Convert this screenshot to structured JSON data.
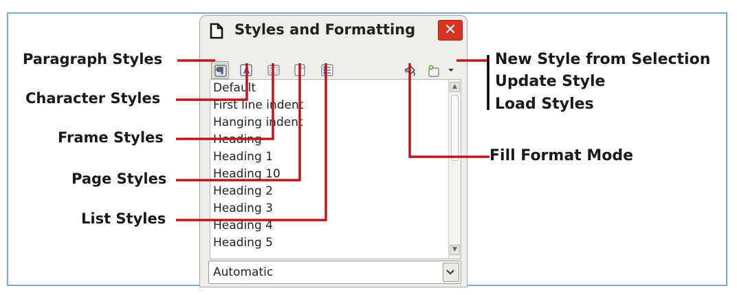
{
  "dialog": {
    "title": "Styles and Formatting",
    "close_label": "✕",
    "toolbar": {
      "paragraph_styles_icon": "paragraph-styles-icon",
      "character_styles_icon": "character-styles-icon",
      "frame_styles_icon": "frame-styles-icon",
      "page_styles_icon": "page-styles-icon",
      "list_styles_icon": "list-styles-icon",
      "fill_format_mode_icon": "fill-format-mode-icon",
      "new_style_icon": "new-style-icon",
      "dropdown_icon": "dropdown-arrow-icon"
    },
    "style_list": [
      "Default",
      "First line indent",
      "Hanging indent",
      "Heading",
      "Heading 1",
      "Heading 10",
      "Heading 2",
      "Heading 3",
      "Heading 4",
      "Heading 5"
    ],
    "filter_value": "Automatic"
  },
  "callouts": {
    "paragraph_styles": "Paragraph Styles",
    "character_styles": "Character Styles",
    "frame_styles": "Frame Styles",
    "page_styles": "Page Styles",
    "list_styles": "List Styles",
    "new_style_from_selection": "New Style from Selection",
    "update_style": "Update Style",
    "load_styles": "Load Styles",
    "fill_format_mode": "Fill Format Mode"
  },
  "colors": {
    "callout_line": "#c0141c",
    "close_button": "#d9321f",
    "frame_border": "#7aa6c8"
  }
}
